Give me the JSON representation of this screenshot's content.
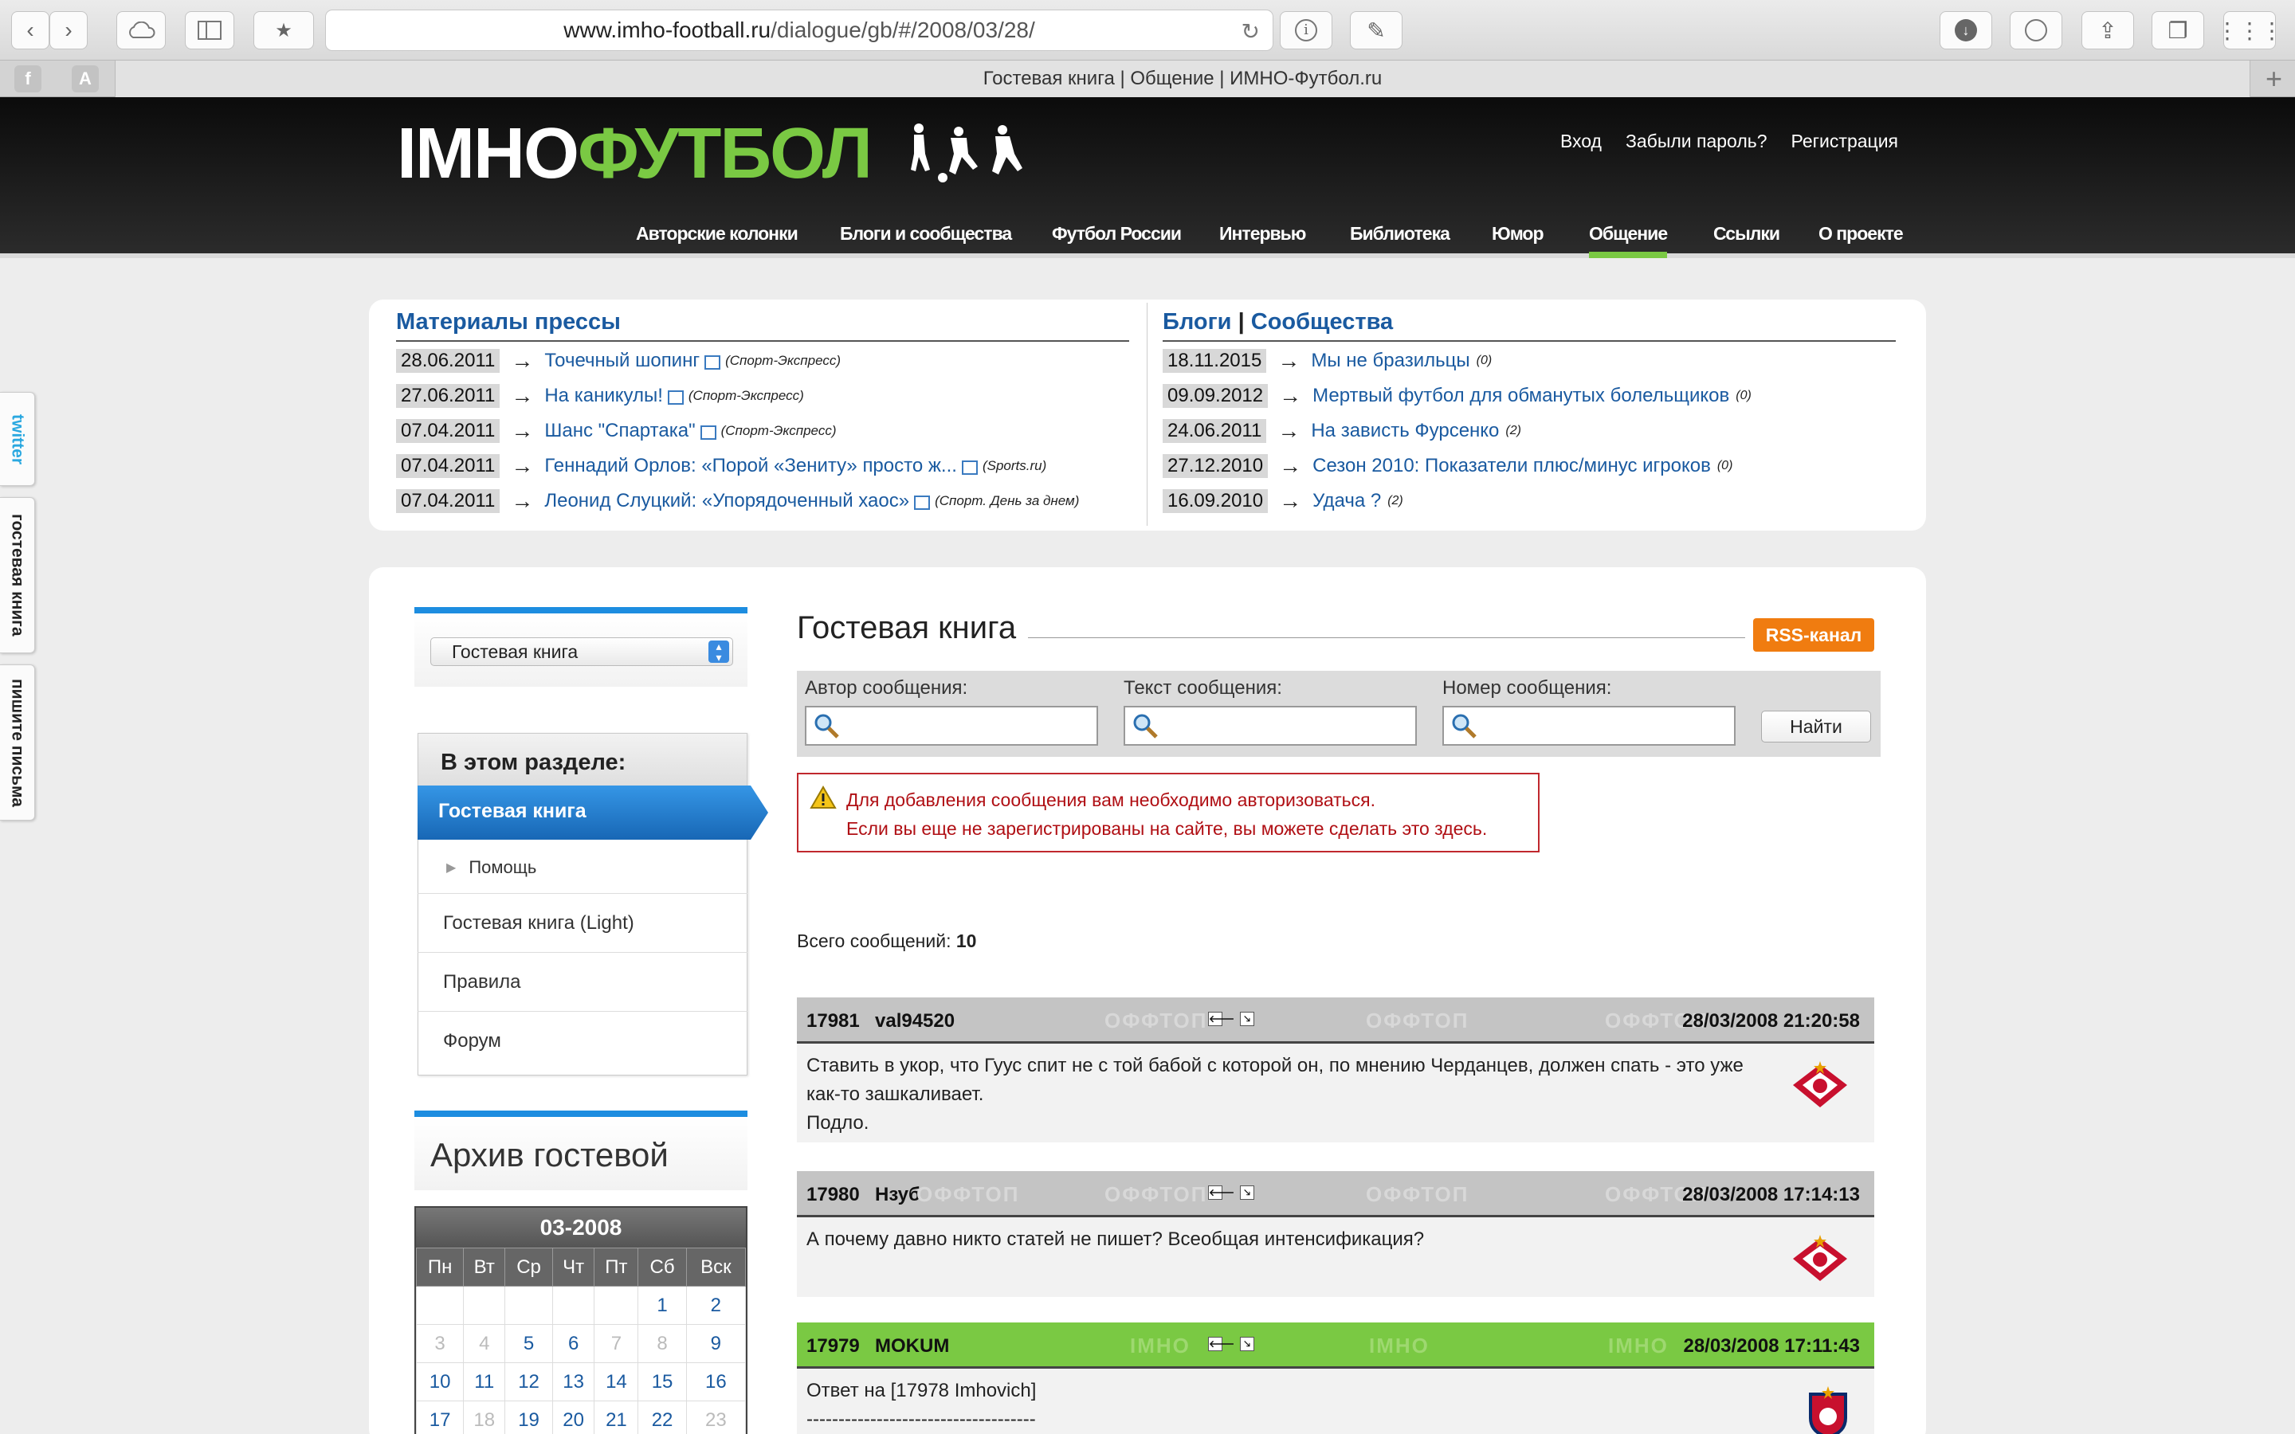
{
  "browser": {
    "url_host": "www.imho-football.ru",
    "url_path": "/dialogue/gb/#/2008/03/28/",
    "tab_title": "Гостевая книга | Общение | ИМНО-Футбол.ru",
    "newtab": "+",
    "fav_a": "A"
  },
  "site": {
    "logo_part1": "IMHO",
    "logo_part2": "ФУТБОЛ",
    "user_links": {
      "login": "Вход",
      "forgot": "Забыли пароль?",
      "register": "Регистрация"
    },
    "nav": [
      "Авторские колонки",
      "Блоги и сообщества",
      "Футбол России",
      "Интервью",
      "Библиотека",
      "Юмор",
      "Общение",
      "Ссылки",
      "О проекте"
    ]
  },
  "side_tabs": {
    "twitter": "twitter",
    "gb": "гостевая книга",
    "letters": "пишите письма"
  },
  "press": {
    "title": "Материалы прессы",
    "items": [
      {
        "date": "28.06.2011",
        "title": "Точечный шопинг",
        "source": "(Спорт-Экспресс)"
      },
      {
        "date": "27.06.2011",
        "title": "На каникулы!",
        "source": "(Спорт-Экспресс)"
      },
      {
        "date": "07.04.2011",
        "title": "Шанс \"Спартака\"",
        "source": "(Спорт-Экспресс)"
      },
      {
        "date": "07.04.2011",
        "title": "Геннадий Орлов: «Порой «Зениту» просто ж...",
        "source": "(Sports.ru)"
      },
      {
        "date": "07.04.2011",
        "title": "Леонид Слуцкий: «Упорядоченный хаос»",
        "source": "(Спорт. День за днем)"
      }
    ]
  },
  "blogs": {
    "title1": "Блоги",
    "sep": "|",
    "title2": "Сообщества",
    "items": [
      {
        "date": "18.11.2015",
        "title": "Мы не бразильцы",
        "count": "(0)"
      },
      {
        "date": "09.09.2012",
        "title": "Мертвый футбол для обманутых болельщиков",
        "count": "(0)"
      },
      {
        "date": "24.06.2011",
        "title": "На зависть Фурсенко",
        "count": "(2)"
      },
      {
        "date": "27.12.2010",
        "title": "Сезон 2010: Показатели плюс/минус игроков",
        "count": "(0)"
      },
      {
        "date": "16.09.2010",
        "title": "Удача ?",
        "count": "(2)"
      }
    ]
  },
  "sidebar": {
    "select_value": "Гостевая книга",
    "section_title": "В этом разделе:",
    "active": "Гостевая книга",
    "items": [
      "Помощь",
      "Гостевая книга (Light)",
      "Правила",
      "Форум"
    ],
    "archive_title": "Архив гостевой"
  },
  "calendar": {
    "month": "03-2008",
    "weekdays": [
      "Пн",
      "Вт",
      "Ср",
      "Чт",
      "Пт",
      "Сб",
      "Вск"
    ],
    "rows": [
      [
        "",
        "",
        "",
        "",
        "",
        "1",
        "2"
      ],
      [
        "3",
        "4",
        "5",
        "6",
        "7",
        "8",
        "9"
      ],
      [
        "10",
        "11",
        "12",
        "13",
        "14",
        "15",
        "16"
      ],
      [
        "17",
        "18",
        "19",
        "20",
        "21",
        "22",
        "23"
      ]
    ],
    "dim_days": [
      "3",
      "4",
      "7",
      "8",
      "18",
      "23"
    ]
  },
  "guestbook": {
    "title": "Гостевая книга",
    "rss": "RSS-канал",
    "search": {
      "author_label": "Автор сообщения:",
      "text_label": "Текст сообщения:",
      "number_label": "Номер сообщения:",
      "button": "Найти"
    },
    "alert_line1": "Для добавления сообщения вам необходимо авторизоваться.",
    "alert_line2": "Если вы еще не зарегистрированы на сайте, вы можете сделать это здесь.",
    "total_label": "Всего сообщений:",
    "total_value": "10",
    "posts": [
      {
        "id": "17981",
        "author": "val94520",
        "datetime": "28/03/2008 21:20:58",
        "watermark": "ОФФТОП",
        "lines": [
          "Ставить в укор, что Гуус спит не с той бабой с которой он, по мнению Черданцев, должен спать - это уже",
          "как-то зашкаливает.",
          "Подло."
        ],
        "club": "Спартак"
      },
      {
        "id": "17980",
        "author": "Нзуб",
        "datetime": "28/03/2008 17:14:13",
        "watermark": "ОФФТОП",
        "lines": [
          "А почему давно никто статей не пишет? Всеобщая интенсификация?"
        ],
        "club": "Спартак"
      },
      {
        "id": "17979",
        "author": "MOKUM",
        "datetime": "28/03/2008 17:11:43",
        "watermark": "IMHO",
        "lines": [
          "Ответ на [17978 Imhovich]",
          "------------------------------------"
        ],
        "club": "ЦСКА"
      }
    ],
    "nav_prev": "🡐",
    "nav_next": "🡖"
  }
}
